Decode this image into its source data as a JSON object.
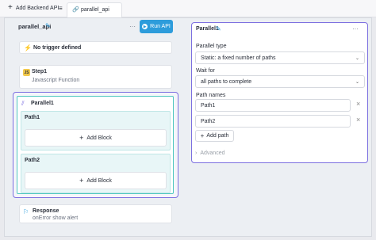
{
  "topbar": {
    "add_backend_api": "Add Backend API",
    "tab_label": "parallel_api"
  },
  "api": {
    "name": "parallel_api",
    "run_label": "Run API",
    "more": "···"
  },
  "flow": {
    "trigger_label": "No trigger defined",
    "step1_title": "Step1",
    "step1_subtitle": "Javascript Function",
    "parallel_title": "Parallel1",
    "path1_label": "Path1",
    "path2_label": "Path2",
    "add_block_label": "Add Block",
    "response_title": "Response",
    "response_subtitle": "onError show alert"
  },
  "panel": {
    "title": "Parallel1",
    "more": "···",
    "parallel_type_label": "Parallel type",
    "parallel_type_value": "Static: a fixed number of paths",
    "wait_for_label": "Wait for",
    "wait_for_value": "all paths to complete",
    "path_names_label": "Path names",
    "paths": [
      "Path1",
      "Path2"
    ],
    "add_path_label": "Add path",
    "advanced_label": "Advanced"
  },
  "colors": {
    "accent_blue": "#2d9cdb",
    "purple_border": "#7c6fe0",
    "teal_border": "#4fc7c0"
  }
}
